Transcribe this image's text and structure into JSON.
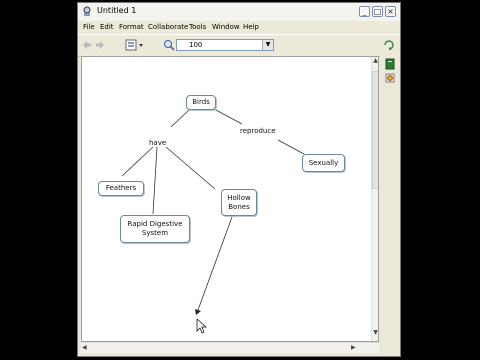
{
  "window": {
    "title": "Untitled 1",
    "minimize": "_",
    "maximize": "□",
    "close": "×"
  },
  "menu": [
    "File",
    "Edit",
    "Format",
    "Collaborate",
    "Tools",
    "Window",
    "Help"
  ],
  "toolbar": {
    "zoom_value": "100"
  },
  "concepts": {
    "birds": "Birds",
    "feathers": "Feathers",
    "rapid_digestive": "Rapid Digestive System",
    "hollow_bones": "Hollow Bones",
    "sexually": "Sexually"
  },
  "linking_phrases": {
    "have": "have",
    "reproduce": "reproduce"
  }
}
